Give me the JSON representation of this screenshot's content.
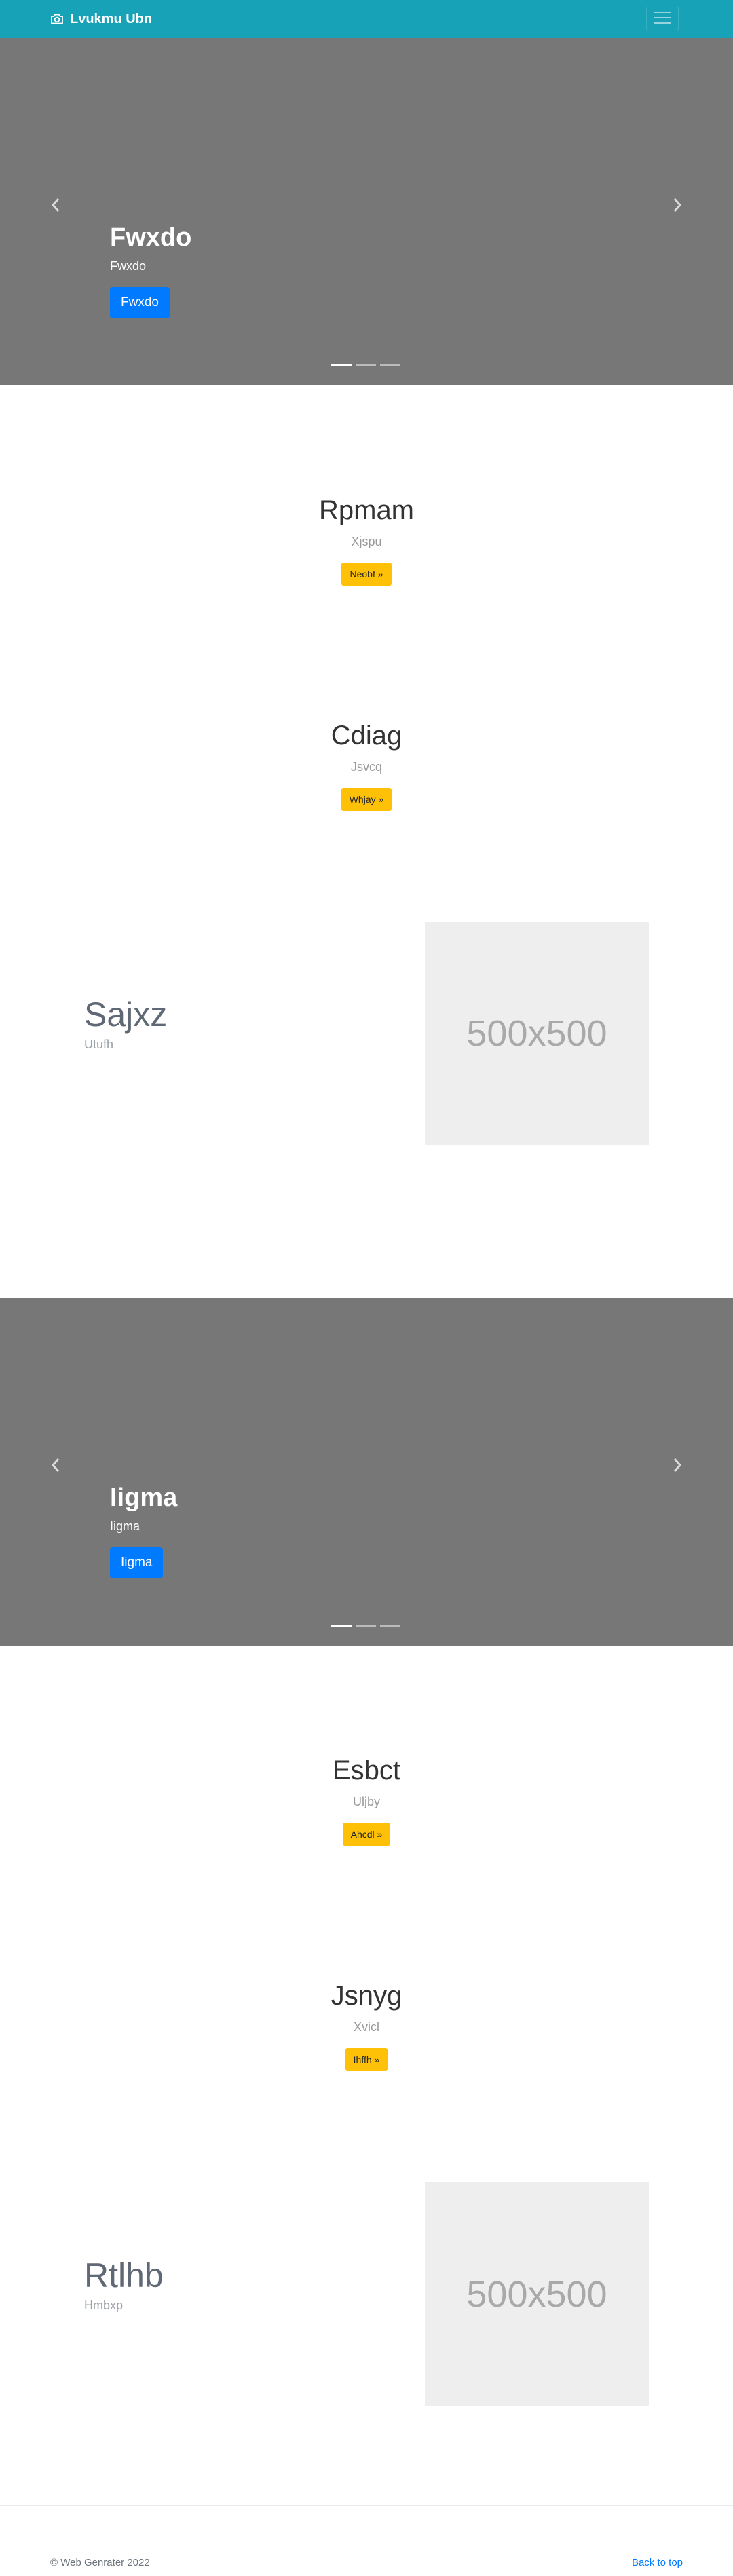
{
  "navbar": {
    "brand": "Lvukmu Ubn",
    "accent_color": "#17a2b8",
    "toggler_icon": "hamburger-icon",
    "brand_icon": "camera-icon"
  },
  "carousel_1": {
    "heading": "Fwxdo",
    "text": "Fwxdo",
    "button": "Fwxdo",
    "slides": 3,
    "active_slide": 1
  },
  "section_1": {
    "heading": "Rpmam",
    "sub": "Xjspu",
    "button": "Neobf »"
  },
  "section_2": {
    "heading": "Cdiag",
    "sub": "Jsvcq",
    "button": "Whjay »"
  },
  "featurette_1": {
    "heading": "Sajxz",
    "sub": "Utufh",
    "image_label": "500x500"
  },
  "carousel_2": {
    "heading": "Iigma",
    "text": "Iigma",
    "button": "Iigma",
    "slides": 3,
    "active_slide": 1
  },
  "section_3": {
    "heading": "Esbct",
    "sub": "Uljby",
    "button": "Ahcdl »"
  },
  "section_4": {
    "heading": "Jsnyg",
    "sub": "Xvicl",
    "button": "Ihffh »"
  },
  "featurette_2": {
    "heading": "Rtlhb",
    "sub": "Hmbxp",
    "image_label": "500x500"
  },
  "footer": {
    "copyright": "© Web Genrater 2022",
    "back_to_top": "Back to top"
  }
}
